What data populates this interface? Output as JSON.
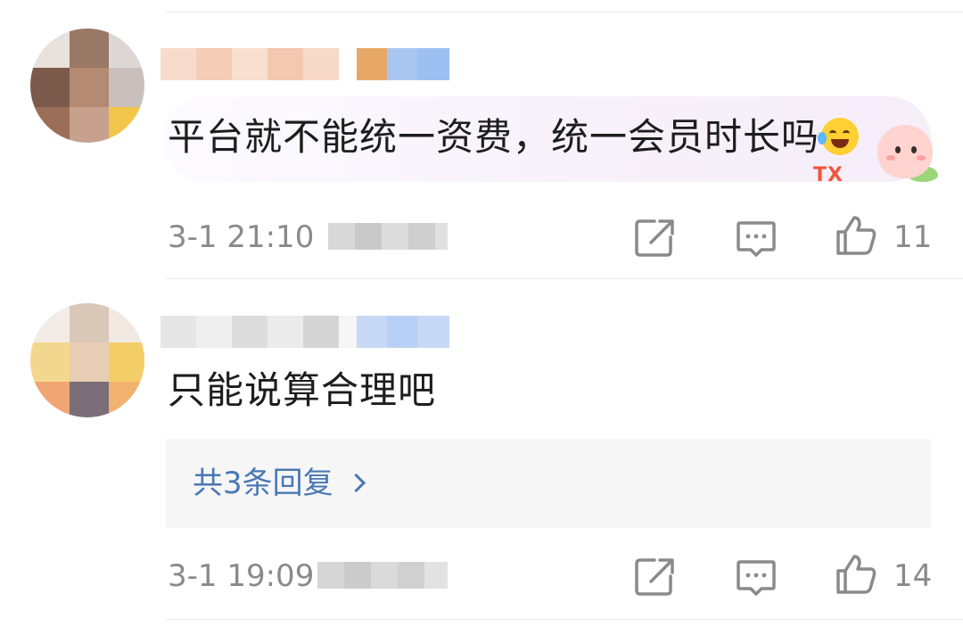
{
  "comments": [
    {
      "text": "平台就不能统一资费，统一会员时长吗",
      "time": "3-1 21:10",
      "likes": "11",
      "emoji_icon": "laughing-crying-emoji",
      "sticker": "peach-bubble-sticker"
    },
    {
      "text": "只能说算合理吧",
      "time": "3-1 19:09",
      "likes": "14",
      "reply_link": "共3条回复"
    }
  ],
  "icons": {
    "share": "share-icon",
    "comment": "comment-icon",
    "like": "thumbs-up-icon",
    "chevron": "chevron-right-icon"
  },
  "colors": {
    "reply_link": "#4a78b4",
    "meta_text": "#8a8a8a",
    "reply_box_bg": "#f6f6f6"
  }
}
